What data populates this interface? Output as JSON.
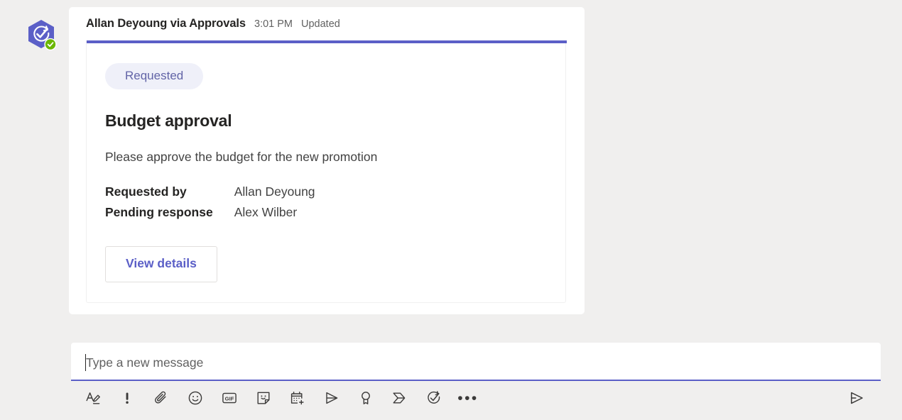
{
  "message": {
    "avatar": {
      "icon": "approvals-app-icon",
      "hex_color": "#5b5fc7",
      "presence_icon": "available-presence-icon",
      "presence_color": "#6bb700"
    },
    "sender": "Allan Deyoung via Approvals",
    "timestamp": "3:01 PM",
    "edited_label": "Updated"
  },
  "card": {
    "accent_color": "#5b5fc7",
    "status_badge": "Requested",
    "status_badge_bg": "#eff0f9",
    "status_badge_color": "#6264a7",
    "title": "Budget approval",
    "description": "Please approve the budget for the new promotion",
    "details": [
      {
        "label": "Requested by",
        "value": "Allan Deyoung"
      },
      {
        "label": "Pending response",
        "value": "Alex Wilber"
      }
    ],
    "action_button": "View details"
  },
  "compose": {
    "placeholder": "Type a new message",
    "focus_color": "#5b5fc7",
    "toolbar": [
      {
        "name": "format-icon",
        "label": "Format"
      },
      {
        "name": "importance-icon",
        "label": "Set delivery options"
      },
      {
        "name": "attach-icon",
        "label": "Attach"
      },
      {
        "name": "emoji-icon",
        "label": "Emoji"
      },
      {
        "name": "gif-icon",
        "label": "Giphy"
      },
      {
        "name": "sticker-icon",
        "label": "Sticker"
      },
      {
        "name": "meeting-icon",
        "label": "Schedule a meeting"
      },
      {
        "name": "stream-icon",
        "label": "Stream"
      },
      {
        "name": "praise-icon",
        "label": "Praise"
      },
      {
        "name": "power-automate-icon",
        "label": "Power Automate"
      },
      {
        "name": "approvals-icon",
        "label": "Approvals"
      },
      {
        "name": "more-options-icon",
        "label": "More options"
      }
    ],
    "send_button": {
      "name": "send-icon",
      "label": "Send"
    }
  }
}
